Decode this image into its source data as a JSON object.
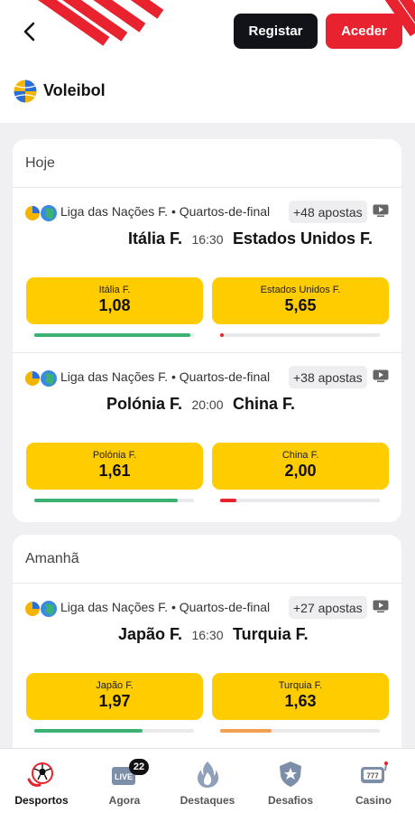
{
  "header": {
    "register_label": "Registar",
    "login_label": "Aceder",
    "brand_color": "#e8222e"
  },
  "sport": {
    "title": "Voleibol",
    "icon": "volleyball-icon"
  },
  "sections": [
    {
      "title": "Hoje",
      "matches": [
        {
          "league": "Liga das Nações F. • Quartos-de-final",
          "bets": "+48 apostas",
          "home": "Itália F.",
          "time": "16:30",
          "away": "Estados Unidos F.",
          "odds": [
            {
              "label": "Itália F.",
              "value": "1,08"
            },
            {
              "label": "Estados Unidos F.",
              "value": "5,65"
            }
          ],
          "bars": [
            {
              "fraction": 0.98,
              "color": "#3bb273"
            },
            {
              "fraction": 0.02,
              "color": "#e8222e"
            }
          ]
        },
        {
          "league": "Liga das Nações F. • Quartos-de-final",
          "bets": "+38 apostas",
          "home": "Polónia F.",
          "time": "20:00",
          "away": "China F.",
          "odds": [
            {
              "label": "Polónia F.",
              "value": "1,61"
            },
            {
              "label": "China F.",
              "value": "2,00"
            }
          ],
          "bars": [
            {
              "fraction": 0.9,
              "color": "#3bb273"
            },
            {
              "fraction": 0.1,
              "color": "#e8222e"
            }
          ]
        }
      ]
    },
    {
      "title": "Amanhã",
      "matches": [
        {
          "league": "Liga das Nações F. • Quartos-de-final",
          "bets": "+27 apostas",
          "home": "Japão F.",
          "time": "16:30",
          "away": "Turquia F.",
          "odds": [
            {
              "label": "Japão F.",
              "value": "1,97"
            },
            {
              "label": "Turquia F.",
              "value": "1,63"
            }
          ],
          "bars": [
            {
              "fraction": 0.68,
              "color": "#3bb273"
            },
            {
              "fraction": 0.32,
              "color": "#f0a050"
            }
          ]
        }
      ]
    }
  ],
  "nav": [
    {
      "label": "Desportos",
      "icon": "football-icon",
      "active": true
    },
    {
      "label": "Agora",
      "icon": "live-tv-icon",
      "badge": "22"
    },
    {
      "label": "Destaques",
      "icon": "flame-icon"
    },
    {
      "label": "Desafios",
      "icon": "star-shield-icon"
    },
    {
      "label": "Casino",
      "icon": "slot-machine-icon"
    }
  ]
}
